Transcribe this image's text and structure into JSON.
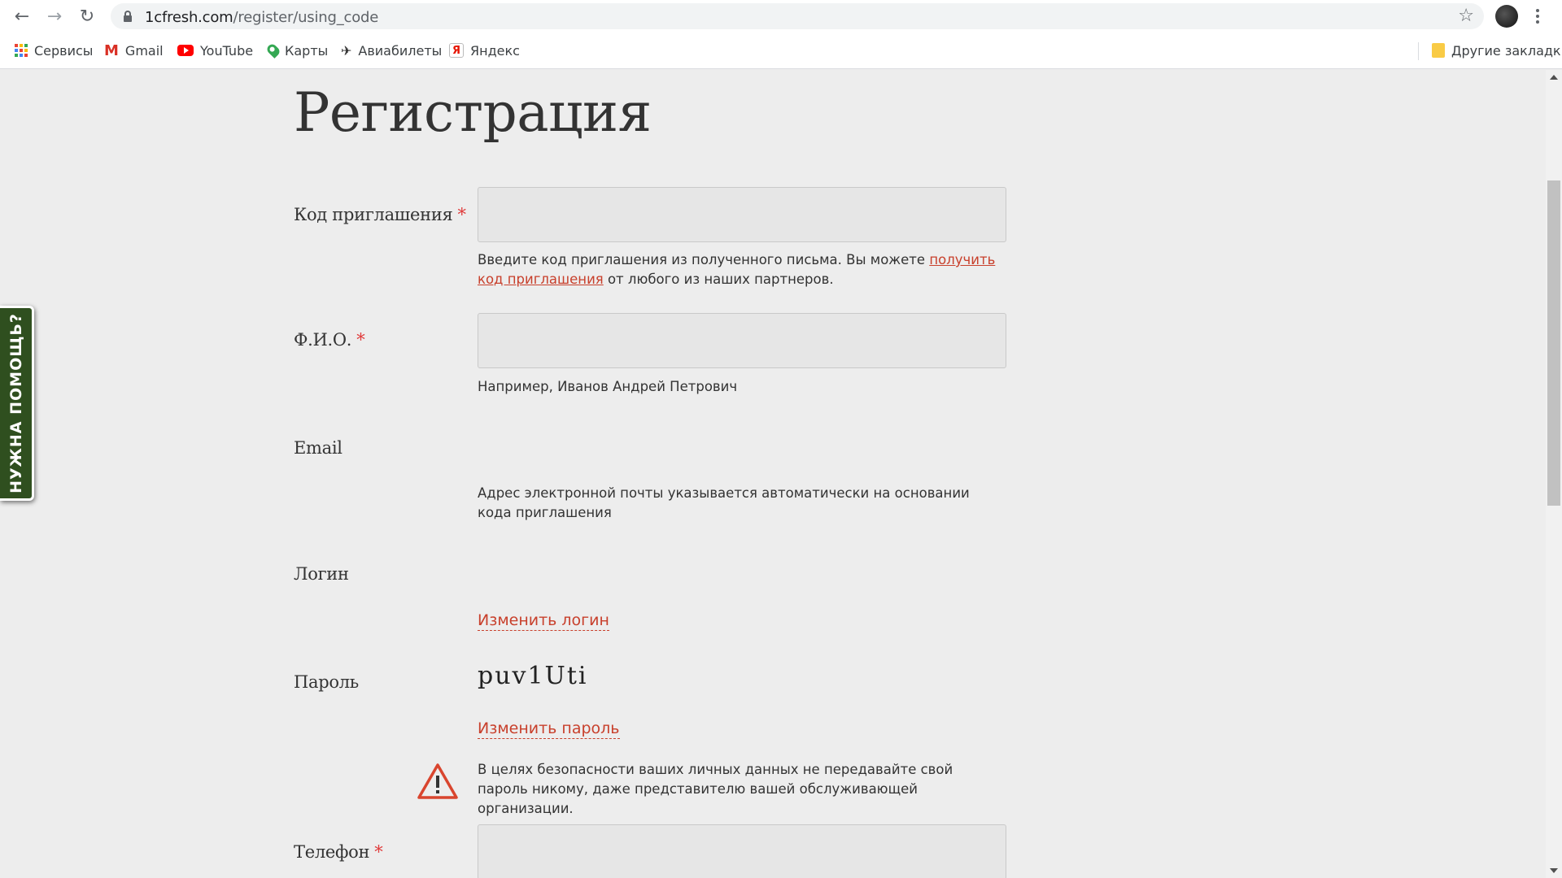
{
  "browser": {
    "url_host": "1cfresh.com",
    "url_path": "/register/using_code",
    "bookmarks": [
      {
        "label": "Сервисы",
        "icon": "apps-grid-icon"
      },
      {
        "label": "Gmail",
        "icon": "gmail-icon"
      },
      {
        "label": "YouTube",
        "icon": "youtube-icon"
      },
      {
        "label": "Карты",
        "icon": "maps-pin-icon"
      },
      {
        "label": "Авиабилеты",
        "icon": "plane-icon"
      },
      {
        "label": "Яндекс",
        "icon": "yandex-icon"
      }
    ],
    "other_bookmarks": "Другие закладки"
  },
  "help_tab": "НУЖНА ПОМОЩЬ?",
  "form": {
    "title": "Регистрация",
    "required_mark": "*",
    "invite_code": {
      "label": "Код приглашения",
      "value": "",
      "hint_before": "Введите код приглашения из полученного письма. Вы можете ",
      "hint_link": "получить код приглашения",
      "hint_after": " от любого из наших партнеров."
    },
    "full_name": {
      "label": "Ф.И.О.",
      "value": "",
      "hint": "Например, Иванов Андрей Петрович"
    },
    "email": {
      "label": "Email",
      "hint": "Адрес электронной почты указывается автоматически на основании кода приглашения"
    },
    "login": {
      "label": "Логин",
      "change_link": "Изменить логин"
    },
    "password": {
      "label": "Пароль",
      "value": "puv1Uti",
      "change_link": "Изменить пароль",
      "warning": "В целях безопасности ваших личных данных не передавайте свой пароль никому, даже представителю вашей обслуживающей организации."
    },
    "phone": {
      "label": "Телефон",
      "value": ""
    }
  },
  "colors": {
    "accent_link": "#c8402c",
    "required": "#e03a3a",
    "help_tab_bg": "#2f4f1f",
    "page_bg": "#ededed"
  }
}
